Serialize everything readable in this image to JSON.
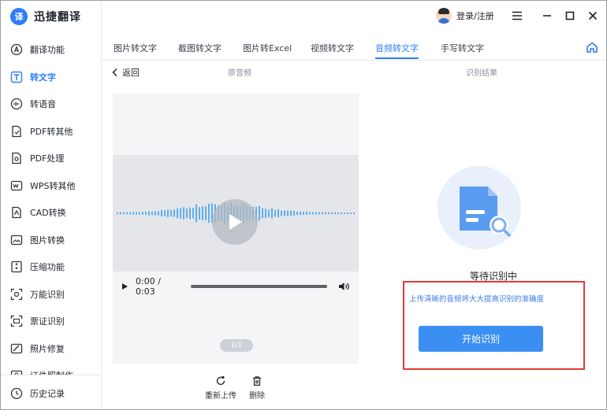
{
  "app": {
    "name": "迅捷翻译",
    "logo_text": "译"
  },
  "sidebar": {
    "items": [
      {
        "label": "翻译功能",
        "icon": "translate-a-icon",
        "active": false
      },
      {
        "label": "转文字",
        "icon": "text-t-icon",
        "active": true
      },
      {
        "label": "转语音",
        "icon": "audio-wave-icon",
        "active": false
      },
      {
        "label": "PDF转其他",
        "icon": "pdf-convert-icon",
        "active": false
      },
      {
        "label": "PDF处理",
        "icon": "pdf-process-icon",
        "active": false
      },
      {
        "label": "WPS转其他",
        "icon": "wps-icon",
        "active": false
      },
      {
        "label": "CAD转换",
        "icon": "cad-icon",
        "active": false
      },
      {
        "label": "图片转换",
        "icon": "image-icon",
        "active": false
      },
      {
        "label": "压缩功能",
        "icon": "compress-icon",
        "active": false
      },
      {
        "label": "万能识别",
        "icon": "scan-icon",
        "active": false
      },
      {
        "label": "票证识别",
        "icon": "ticket-icon",
        "active": false
      },
      {
        "label": "照片修复",
        "icon": "photo-fix-icon",
        "active": false
      },
      {
        "label": "证件照制作",
        "icon": "id-photo-icon",
        "active": false
      }
    ],
    "history_label": "历史记录"
  },
  "topbar": {
    "login_label": "登录/注册"
  },
  "tabs": [
    {
      "label": "图片转文字",
      "active": false
    },
    {
      "label": "截图转文字",
      "active": false
    },
    {
      "label": "图片转Excel",
      "active": false
    },
    {
      "label": "视频转文字",
      "active": false
    },
    {
      "label": "音频转文字",
      "active": true
    },
    {
      "label": "手写转文字",
      "active": false
    }
  ],
  "subheader": {
    "back_label": "返回",
    "left_label": "原音频",
    "right_label": "识别结果"
  },
  "player": {
    "time": "0:00 / 0:03",
    "page": "1/1"
  },
  "actions": {
    "reupload_label": "重新上传",
    "delete_label": "删除"
  },
  "result": {
    "status": "等待识别中",
    "hint": "上传清晰的音频将大大提高识别的准确度",
    "start_label": "开始识别"
  },
  "colors": {
    "accent": "#2d7ef7",
    "button": "#3b8ff3",
    "highlight_border": "#e53935",
    "wave": "#3ea0ee"
  }
}
